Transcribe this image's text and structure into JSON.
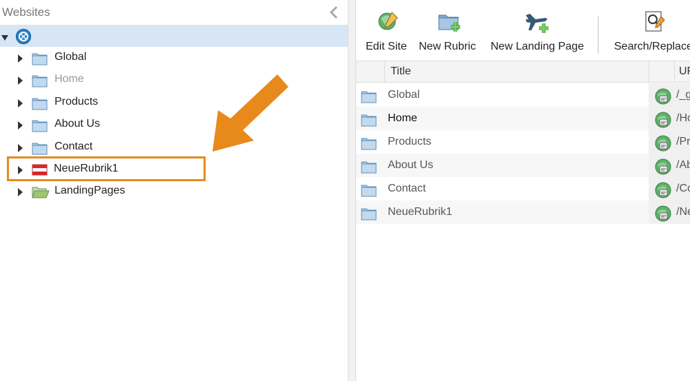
{
  "left_panel": {
    "title": "Websites",
    "tree": [
      {
        "label": "Global",
        "dim": false,
        "icon": "folder-icon"
      },
      {
        "label": "Home",
        "dim": true,
        "icon": "folder-icon"
      },
      {
        "label": "Products",
        "dim": false,
        "icon": "folder-icon"
      },
      {
        "label": "About Us",
        "dim": false,
        "icon": "folder-icon"
      },
      {
        "label": "Contact",
        "dim": false,
        "icon": "folder-icon"
      },
      {
        "label": "NeueRubrik1",
        "dim": false,
        "icon": "red-white-flag-icon",
        "highlighted": true
      },
      {
        "label": "LandingPages",
        "dim": false,
        "icon": "open-folder-icon"
      }
    ]
  },
  "toolbar": {
    "edit_site": "Edit Site",
    "new_rubric": "New Rubric",
    "new_landing_page": "New Landing Page",
    "search_replace": "Search/Replace"
  },
  "grid": {
    "col_title": "Title",
    "col_url": "URL",
    "rows": [
      {
        "title": "Global",
        "url": "/_g"
      },
      {
        "title": "Home",
        "url": "/Ho"
      },
      {
        "title": "Products",
        "url": "/Pr"
      },
      {
        "title": "About Us",
        "url": "/Ab"
      },
      {
        "title": "Contact",
        "url": "/Co"
      },
      {
        "title": "NeueRubrik1",
        "url": "/Ne"
      }
    ]
  },
  "colors": {
    "accent_orange": "#e8891c",
    "selection_blue": "#d6e6f4",
    "folder_blue": "#8fb6d8"
  }
}
